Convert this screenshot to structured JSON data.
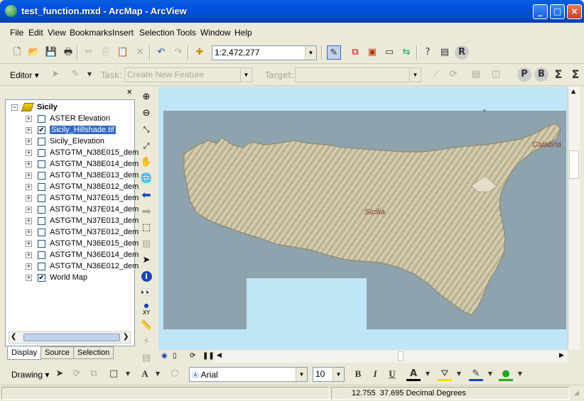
{
  "window": {
    "title": "test_function.mxd - ArcMap - ArcView"
  },
  "menu": [
    "File",
    "Edit",
    "View",
    "Bookmarks",
    "Insert",
    "Selection",
    "Tools",
    "Window",
    "Help"
  ],
  "standard_toolbar": {
    "scale": "1:2,472,277"
  },
  "editor_toolbar": {
    "editor_label": "Editor",
    "task_label": "Task:",
    "task_value": "Create New Feature",
    "target_label": "Target:",
    "target_value": ""
  },
  "toc": {
    "root": "Sicily",
    "layers": [
      {
        "name": "ASTER Elevation",
        "checked": false
      },
      {
        "name": "Sicily_Hillshade.tif",
        "checked": true,
        "selected": true
      },
      {
        "name": "Sicily_Elevation",
        "checked": false
      },
      {
        "name": "ASTGTM_N38E015_dem",
        "checked": false
      },
      {
        "name": "ASTGTM_N38E014_dem",
        "checked": false
      },
      {
        "name": "ASTGTM_N38E013_dem",
        "checked": false
      },
      {
        "name": "ASTGTM_N38E012_dem",
        "checked": false
      },
      {
        "name": "ASTGTM_N37E015_dem",
        "checked": false
      },
      {
        "name": "ASTGTM_N37E014_dem",
        "checked": false
      },
      {
        "name": "ASTGTM_N37E013_dem",
        "checked": false
      },
      {
        "name": "ASTGTM_N37E012_dem",
        "checked": false
      },
      {
        "name": "ASTGTM_N36E015_dem",
        "checked": false
      },
      {
        "name": "ASTGTM_N36E014_dem",
        "checked": false
      },
      {
        "name": "ASTGTM_N36E012_dem",
        "checked": false
      },
      {
        "name": "World Map",
        "checked": true
      }
    ],
    "tabs": [
      "Display",
      "Source",
      "Selection"
    ]
  },
  "map": {
    "labels": {
      "sicilia": "Sicilia",
      "calabria": "Calabria"
    }
  },
  "drawing_toolbar": {
    "drawing_label": "Drawing",
    "font": "Arial",
    "size": "10"
  },
  "status": {
    "coords": "12.755  37.695 Decimal Degrees"
  },
  "colors": {
    "water": "#bfe6f6",
    "land": "#c9c1a2",
    "sea_dark": "#8ea3ad"
  }
}
